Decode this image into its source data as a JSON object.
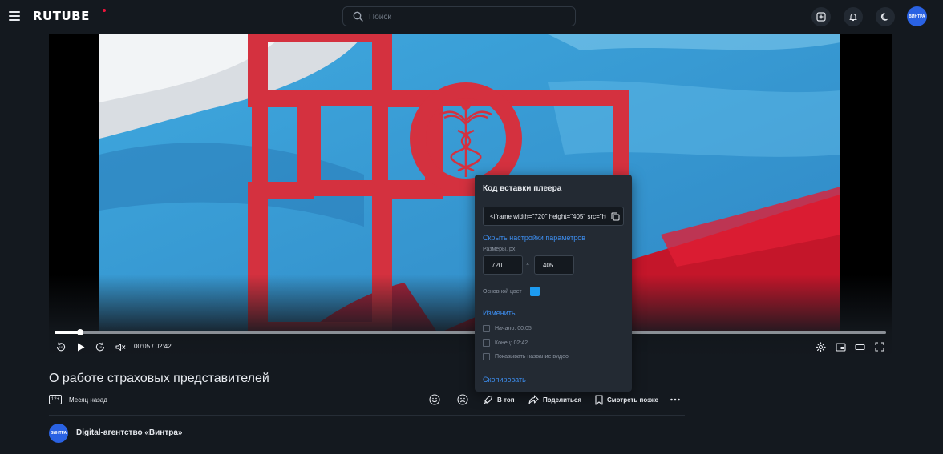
{
  "header": {
    "logo": "RUTUBE",
    "search_placeholder": "Поиск",
    "avatar_text": "ВИНТРА"
  },
  "player": {
    "time": "00:05 / 02:42",
    "progress": 0.031
  },
  "embed": {
    "title": "Код вставки плеера",
    "code": "<iframe width=\"720\" height=\"405\" src=\"https://rutube.ru/play/embed/",
    "hide_settings": "Скрыть настройки параметров",
    "size_label": "Размеры, px:",
    "width": "720",
    "times": "×",
    "height": "405",
    "color_label": "Основной цвет",
    "color": "#1d9bf0",
    "change": "Изменить",
    "start": "Начало: 00:05",
    "end": "Конец: 02:42",
    "show_title": "Показывать название видео",
    "copy": "Скопировать"
  },
  "video": {
    "title": "О работе страховых представителей",
    "age": "12+",
    "published": "Месяц назад",
    "actions": {
      "top": "В топ",
      "share": "Поделиться",
      "later": "Смотреть позже"
    }
  },
  "channel": {
    "avatar_text": "ВИНТРА",
    "name": "Digital-агентство «Винтра»"
  },
  "colors": {
    "background": "#14191f",
    "accent": "#3d8ef0",
    "brand_red": "#ed143b"
  }
}
